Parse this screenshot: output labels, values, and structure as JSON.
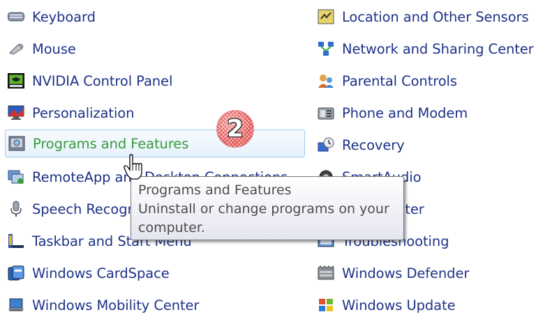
{
  "left_column": [
    {
      "label": "Keyboard",
      "icon": "keyboard-icon"
    },
    {
      "label": "Mouse",
      "icon": "mouse-icon"
    },
    {
      "label": "NVIDIA Control Panel",
      "icon": "nvidia-icon"
    },
    {
      "label": "Personalization",
      "icon": "personalization-icon"
    },
    {
      "label": "Programs and Features",
      "icon": "programs-features-icon"
    },
    {
      "label": "RemoteApp and Desktop Connections",
      "icon": "remoteapp-icon"
    },
    {
      "label": "Speech Recognition",
      "icon": "microphone-icon"
    },
    {
      "label": "Taskbar and Start Menu",
      "icon": "taskbar-icon"
    },
    {
      "label": "Windows CardSpace",
      "icon": "cardspace-icon"
    },
    {
      "label": "Windows Mobility Center",
      "icon": "mobility-center-icon"
    }
  ],
  "right_column": [
    {
      "label": "Location and Other Sensors",
      "icon": "sensors-icon"
    },
    {
      "label": "Network and Sharing Center",
      "icon": "network-icon"
    },
    {
      "label": "Parental Controls",
      "icon": "parental-controls-icon"
    },
    {
      "label": "Phone and Modem",
      "icon": "phone-modem-icon"
    },
    {
      "label": "Recovery",
      "icon": "recovery-icon"
    },
    {
      "label": "SmartAudio",
      "icon": "smartaudio-icon"
    },
    {
      "label": "Sync Center",
      "icon": "sync-center-icon"
    },
    {
      "label": "Troubleshooting",
      "icon": "troubleshooting-icon"
    },
    {
      "label": "Windows Defender",
      "icon": "defender-icon"
    },
    {
      "label": "Windows Update",
      "icon": "windows-update-icon"
    }
  ],
  "tooltip": {
    "title": "Programs and Features",
    "line1": "Uninstall or change programs on your",
    "line2": "computer."
  },
  "step_badge": {
    "number": "2"
  },
  "colors": {
    "link": "#1e3287",
    "hover_link": "#3a9a3a",
    "hover_border": "#9fc9ef"
  }
}
